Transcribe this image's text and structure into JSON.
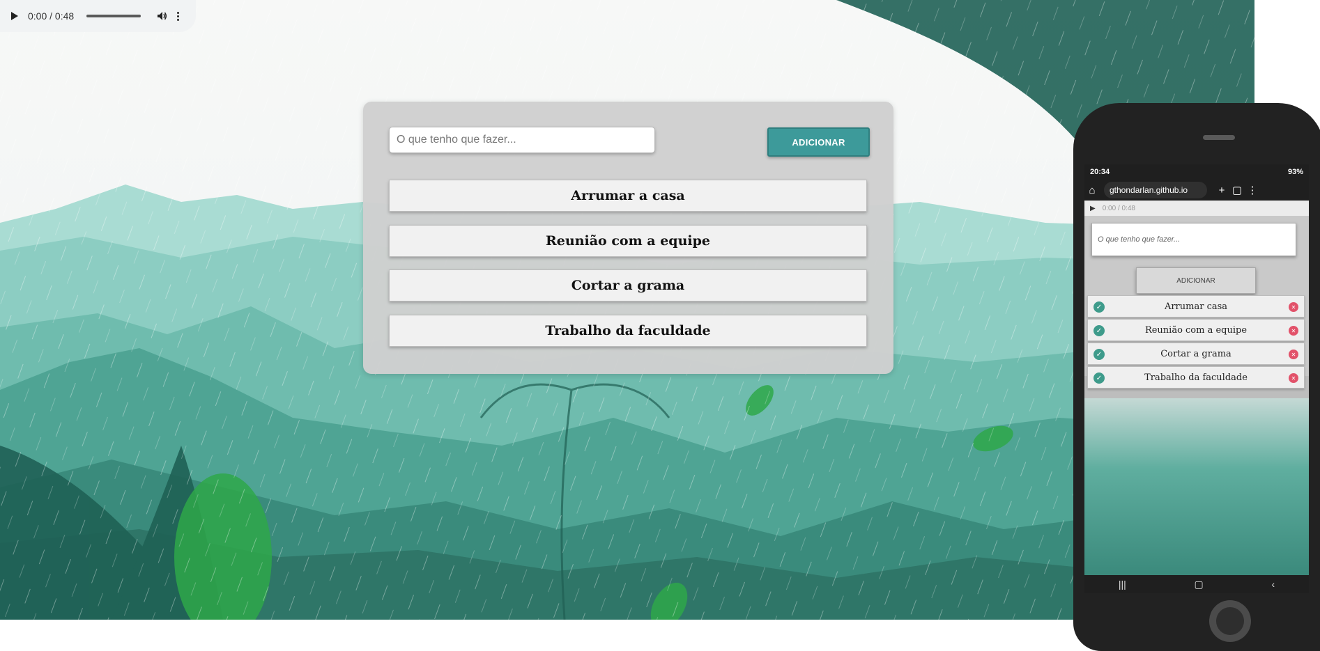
{
  "audio": {
    "time": "0:00 / 0:48"
  },
  "todo": {
    "input_placeholder": "O que tenho que fazer...",
    "add_label": "ADICIONAR",
    "tasks": [
      "Arrumar a casa",
      "Reunião com a equipe",
      "Cortar a grama",
      "Trabalho da faculdade"
    ]
  },
  "phone": {
    "clock": "20:34",
    "battery": "93%",
    "url": "gthondarlan.github.io",
    "audio_time": "0:00 / 0:48",
    "input_placeholder": "O que tenho que fazer...",
    "add_label": "ADICIONAR",
    "tasks": [
      "Arrumar casa",
      "Reunião com a equipe",
      "Cortar a grama",
      "Trabalho da faculdade"
    ]
  },
  "colors": {
    "accent": "#3d9a9a",
    "delete": "#e2526a",
    "check": "#3e9b8b"
  }
}
